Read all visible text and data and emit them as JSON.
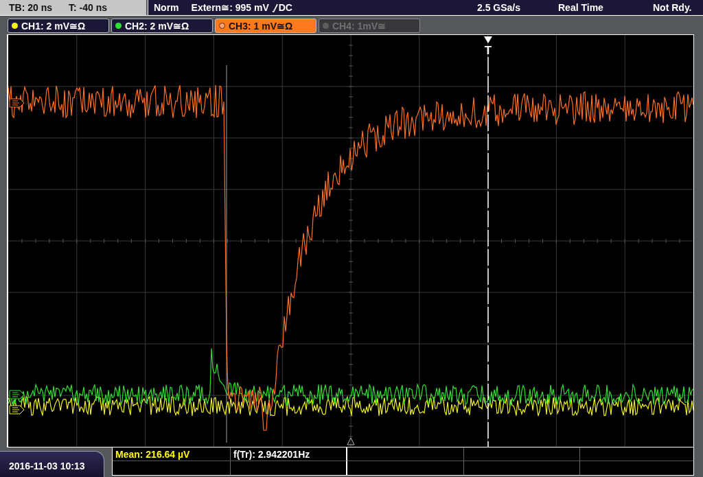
{
  "status_bar": {
    "timebase": "TB: 20 ns",
    "trigger_offset": "T: -40 ns",
    "trigger_mode": "Norm",
    "trigger_source": "Extern≅: 995 mV",
    "trigger_coupling": "DC",
    "sample_rate": "2.5 GSa/s",
    "acquisition": "Real Time",
    "state": "Not Rdy."
  },
  "channels": [
    {
      "label": "CH1: 2 mV≅Ω",
      "color": "#f2f21e",
      "selected": false,
      "disabled": false
    },
    {
      "label": "CH2: 2 mV≅Ω",
      "color": "#30e030",
      "selected": false,
      "disabled": false
    },
    {
      "label": "CH3: 1 mV≅Ω",
      "color": "#ffa070",
      "selected": true,
      "disabled": false
    },
    {
      "label": "CH4: 1mV≅",
      "color": "#5e5e5e",
      "selected": false,
      "disabled": true
    }
  ],
  "display": {
    "trigger_label": "T"
  },
  "footer": {
    "datetime": "2016-11-03 10:13",
    "measurements": [
      {
        "text": "Mean: 216.64 µV",
        "color": "#ffff00"
      },
      {
        "text": "f(Tr): 2.942201Hz",
        "color": "#ffffff"
      }
    ]
  }
}
